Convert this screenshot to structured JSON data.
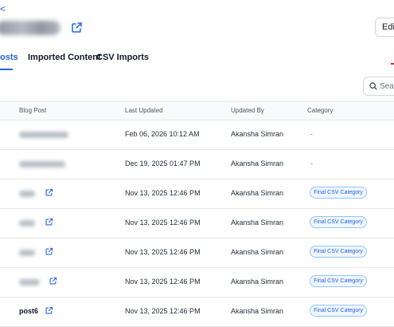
{
  "nav": {
    "back_label": "<"
  },
  "header": {
    "edit_label": "Edit"
  },
  "tabs": [
    {
      "label": "Posts",
      "visible_label": "osts"
    },
    {
      "label": "Imported Content"
    },
    {
      "label": "CSV Imports"
    }
  ],
  "search": {
    "placeholder": "Search"
  },
  "table": {
    "columns": [
      "Blog Post",
      "Last Updated",
      "Updated By",
      "Category"
    ],
    "rows": [
      {
        "title": "",
        "updated": "Feb 06, 2026 10:12 AM",
        "by": "Akansha Simran",
        "category": "-"
      },
      {
        "title": "",
        "updated": "Dec 19, 2025 01:47 PM",
        "by": "Akansha Simran",
        "category": "-"
      },
      {
        "title": "",
        "updated": "Nov 13, 2025 12:46 PM",
        "by": "Akansha Simran",
        "category": "Final CSV Category"
      },
      {
        "title": "",
        "updated": "Nov 13, 2025 12:46 PM",
        "by": "Akansha Simran",
        "category": "Final CSV Category"
      },
      {
        "title": "",
        "updated": "Nov 13, 2025 12:46 PM",
        "by": "Akansha Simran",
        "category": "Final CSV Category"
      },
      {
        "title": "",
        "updated": "Nov 13, 2025 12:46 PM",
        "by": "Akansha Simran",
        "category": "Final CSV Category"
      },
      {
        "title": "post6",
        "updated": "Nov 13, 2025 12:46 PM",
        "by": "Akansha Simran",
        "category": "Final CSV Category"
      }
    ]
  },
  "colors": {
    "accent": "#2563eb",
    "badge_bg": "#eff6ff",
    "badge_border": "#93c5fd",
    "marker": "#dc2626"
  },
  "icons": {
    "external_link": "external-link-icon",
    "search": "search-icon"
  }
}
